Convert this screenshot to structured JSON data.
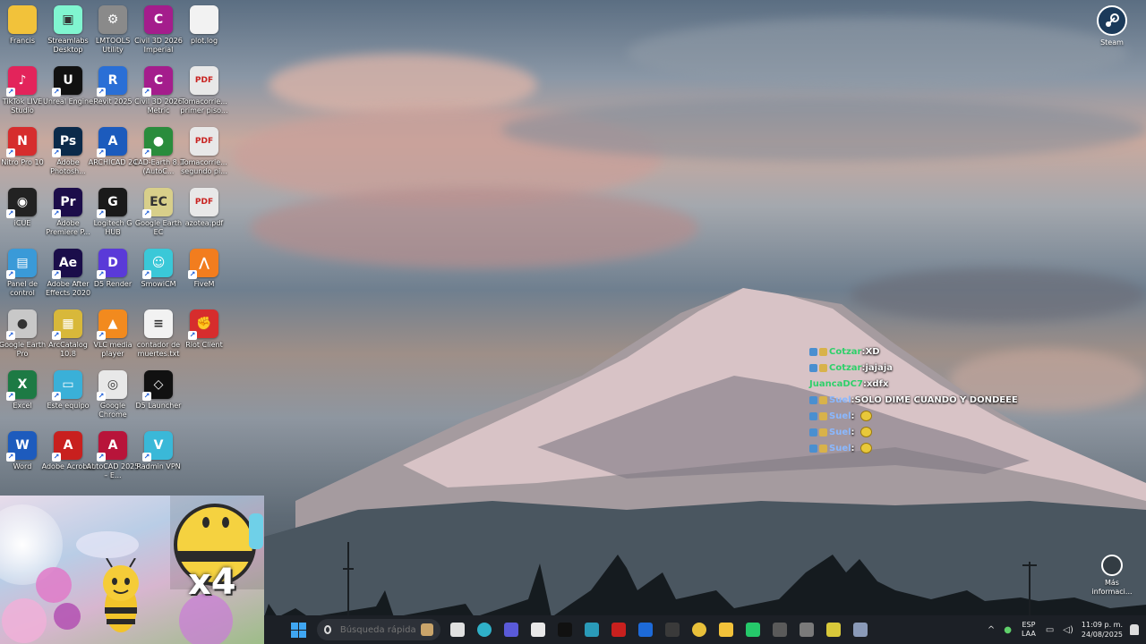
{
  "desktop_icons": [
    {
      "label": "Francis",
      "color": "#f2c23a",
      "glyph": "",
      "col": 0,
      "row": 0
    },
    {
      "label": "Streamlabs Desktop",
      "color": "#80f5d0",
      "glyph": "▣",
      "col": 1,
      "row": 0
    },
    {
      "label": "LMTOOLS Utility",
      "color": "#8a8a8a",
      "glyph": "⚙",
      "col": 2,
      "row": 0
    },
    {
      "label": "Civil 3D 2026 Imperial",
      "color": "#a41d8c",
      "glyph": "C",
      "col": 3,
      "row": 0
    },
    {
      "label": "plot.log",
      "color": "#f2f2f2",
      "glyph": "",
      "col": 4,
      "row": 0
    },
    {
      "label": "TikTok LIVE Studio",
      "color": "#e3245b",
      "glyph": "♪",
      "col": 0,
      "row": 1
    },
    {
      "label": "Unreal Engine",
      "color": "#111111",
      "glyph": "U",
      "col": 1,
      "row": 1
    },
    {
      "label": "Revit 2025",
      "color": "#2a6fd6",
      "glyph": "R",
      "col": 2,
      "row": 1
    },
    {
      "label": "Civil 3D 2026 Metric",
      "color": "#a41d8c",
      "glyph": "C",
      "col": 3,
      "row": 1
    },
    {
      "label": "Tomacorrie... primer piso...",
      "color": "#e8e8e8",
      "glyph": "PDF",
      "col": 4,
      "row": 1
    },
    {
      "label": "Nitro Pro 10",
      "color": "#d62d2d",
      "glyph": "N",
      "col": 0,
      "row": 2
    },
    {
      "label": "Adobe Photosh...",
      "color": "#0b2a4a",
      "glyph": "Ps",
      "col": 1,
      "row": 2
    },
    {
      "label": "ARCHICAD 24",
      "color": "#1c5bbd",
      "glyph": "A",
      "col": 2,
      "row": 2
    },
    {
      "label": "CAD-Earth 8.1 (AutoC...",
      "color": "#2a8c3c",
      "glyph": "●",
      "col": 3,
      "row": 2
    },
    {
      "label": "Tomacorrie... segundo pi...",
      "color": "#e8e8e8",
      "glyph": "PDF",
      "col": 4,
      "row": 2
    },
    {
      "label": "iCUE",
      "color": "#222222",
      "glyph": "◉",
      "col": 0,
      "row": 3
    },
    {
      "label": "Adobe Premiere P...",
      "color": "#1c0d4a",
      "glyph": "Pr",
      "col": 1,
      "row": 3
    },
    {
      "label": "Logitech G HUB",
      "color": "#1a1a1a",
      "glyph": "G",
      "col": 2,
      "row": 3
    },
    {
      "label": "Google Earth EC",
      "color": "#d8cf8a",
      "glyph": "EC",
      "col": 3,
      "row": 3
    },
    {
      "label": "azotea.pdf",
      "color": "#e8e8e8",
      "glyph": "PDF",
      "col": 4,
      "row": 3
    },
    {
      "label": "Panel de control",
      "color": "#3a9ad8",
      "glyph": "▤",
      "col": 0,
      "row": 4
    },
    {
      "label": "Adobe After Effects 2020",
      "color": "#1a0d4a",
      "glyph": "Ae",
      "col": 1,
      "row": 4
    },
    {
      "label": "D5 Render",
      "color": "#5a3ad8",
      "glyph": "D",
      "col": 2,
      "row": 4
    },
    {
      "label": "SmowiCM",
      "color": "#3ac8d8",
      "glyph": "☺",
      "col": 3,
      "row": 4
    },
    {
      "label": "FiveM",
      "color": "#f27d1e",
      "glyph": "⋀",
      "col": 4,
      "row": 4
    },
    {
      "label": "Google Earth Pro",
      "color": "#c8c8c8",
      "glyph": "●",
      "col": 0,
      "row": 5
    },
    {
      "label": "ArcCatalog 10.8",
      "color": "#d8b83a",
      "glyph": "▦",
      "col": 1,
      "row": 5
    },
    {
      "label": "VLC media player",
      "color": "#f28a1e",
      "glyph": "▲",
      "col": 2,
      "row": 5
    },
    {
      "label": "contador de muertes.txt",
      "color": "#f2f2f2",
      "glyph": "≡",
      "col": 3,
      "row": 5
    },
    {
      "label": "Riot Client",
      "color": "#d62d2d",
      "glyph": "✊",
      "col": 4,
      "row": 5
    },
    {
      "label": "Excel",
      "color": "#1d7a44",
      "glyph": "X",
      "col": 0,
      "row": 6
    },
    {
      "label": "Este equipo",
      "color": "#3ab0d8",
      "glyph": "▭",
      "col": 1,
      "row": 6
    },
    {
      "label": "Google Chrome",
      "color": "#e8e8e8",
      "glyph": "◎",
      "col": 2,
      "row": 6
    },
    {
      "label": "D5 Launcher",
      "color": "#111111",
      "glyph": "◇",
      "col": 3,
      "row": 6
    },
    {
      "label": "Word",
      "color": "#1d5bbd",
      "glyph": "W",
      "col": 0,
      "row": 7
    },
    {
      "label": "Adobe Acrobat",
      "color": "#c8201e",
      "glyph": "A",
      "col": 1,
      "row": 7
    },
    {
      "label": "AutoCAD 2025 – E...",
      "color": "#b8143a",
      "glyph": "A",
      "col": 2,
      "row": 7
    },
    {
      "label": "Radmin VPN",
      "color": "#3ab8d8",
      "glyph": "V",
      "col": 3,
      "row": 7
    }
  ],
  "steam": {
    "label": "Steam"
  },
  "more_info": {
    "label": "Más informaci..."
  },
  "chat": [
    {
      "name": "Cotzar",
      "sep": ": ",
      "msg": "XD",
      "cls": "cname-green",
      "badges": true
    },
    {
      "name": "Cotzar",
      "sep": ": ",
      "msg": "jajaja",
      "cls": "cname-green",
      "badges": true
    },
    {
      "name": "JuancaDC7",
      "sep": ": ",
      "msg": "xdfx",
      "cls": "cname-green",
      "badges": false
    },
    {
      "name": "Suel",
      "sep": ": ",
      "msg": "SOLO DIME CUANDO Y DONDEEE",
      "cls": "cname-lblue",
      "badges": true
    },
    {
      "name": "Suel",
      "sep": ": ",
      "msg": "",
      "cls": "cname-lblue",
      "badges": true,
      "emoji": true
    },
    {
      "name": "Suel",
      "sep": ": ",
      "msg": "",
      "cls": "cname-lblue",
      "badges": true,
      "emoji": true
    },
    {
      "name": "Suel",
      "sep": ": ",
      "msg": "",
      "cls": "cname-lblue",
      "badges": true,
      "emoji": true
    }
  ],
  "overlay": {
    "multiplier": "x4"
  },
  "taskbar": {
    "search_placeholder": "Búsqueda rápida",
    "apps": [
      {
        "name": "task-view",
        "color": "#e0e0e0"
      },
      {
        "name": "edge",
        "color": "#2fb0c8"
      },
      {
        "name": "teams",
        "color": "#5a5ad8"
      },
      {
        "name": "store",
        "color": "#e8e8e8"
      },
      {
        "name": "tiktok",
        "color": "#111111"
      },
      {
        "name": "app-folder",
        "color": "#2a9ab8"
      },
      {
        "name": "acrobat",
        "color": "#c8201e"
      },
      {
        "name": "outlook",
        "color": "#1d6ad8"
      },
      {
        "name": "snipping",
        "color": "#3a3a3a"
      },
      {
        "name": "chrome",
        "color": "#e8c03a"
      },
      {
        "name": "file-explorer",
        "color": "#f2c23a"
      },
      {
        "name": "whatsapp",
        "color": "#25c86a"
      },
      {
        "name": "app-dark",
        "color": "#5a5a5a"
      },
      {
        "name": "app-circle",
        "color": "#7a7a7a"
      },
      {
        "name": "app-yellow",
        "color": "#d8c83a"
      },
      {
        "name": "settings",
        "color": "#8a9ab8"
      }
    ],
    "lang_top": "ESP",
    "lang_bottom": "LAA",
    "time": "11:09 p. m.",
    "date": "24/08/2025"
  }
}
